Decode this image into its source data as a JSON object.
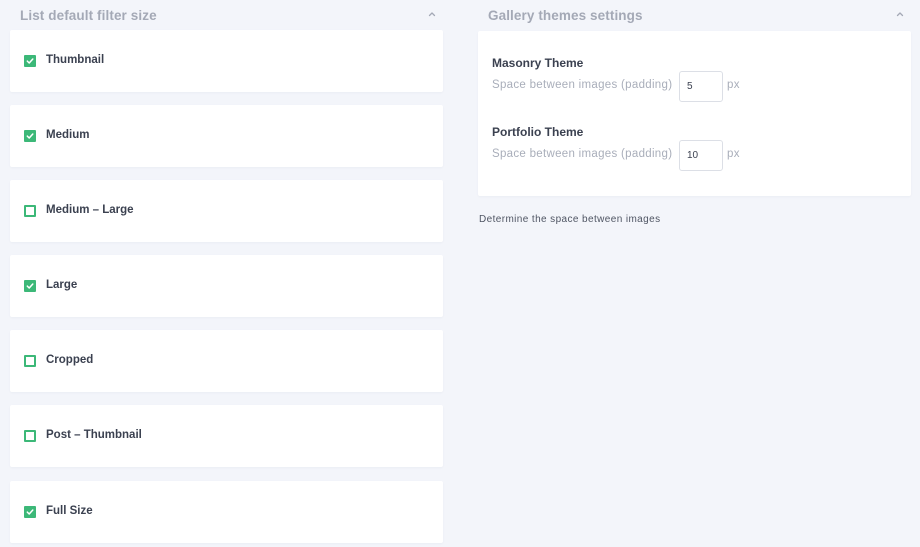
{
  "filter_section": {
    "title": "List default filter size",
    "collapse_icon": "chevron-up-icon",
    "options": [
      {
        "label": "Thumbnail",
        "checked": true
      },
      {
        "label": "Medium",
        "checked": true
      },
      {
        "label": "Medium – Large",
        "checked": false
      },
      {
        "label": "Large",
        "checked": true
      },
      {
        "label": "Cropped",
        "checked": false
      },
      {
        "label": "Post – Thumbnail",
        "checked": false
      },
      {
        "label": "Full Size",
        "checked": true
      }
    ]
  },
  "gallery_section": {
    "title": "Gallery themes settings",
    "collapse_icon": "chevron-up-icon",
    "masonry": {
      "title": "Masonry Theme",
      "label": "Space between images (padding)",
      "value": "5",
      "unit": "px"
    },
    "portfolio": {
      "title": "Portfolio Theme",
      "label": "Space between images (padding)",
      "value": "10",
      "unit": "px"
    },
    "help_text": "Determine the space between images"
  },
  "colors": {
    "accent": "#3cb878",
    "background": "#f3f5fa",
    "card": "#ffffff",
    "muted_text": "#a4a9b6",
    "text": "#3b4150"
  }
}
